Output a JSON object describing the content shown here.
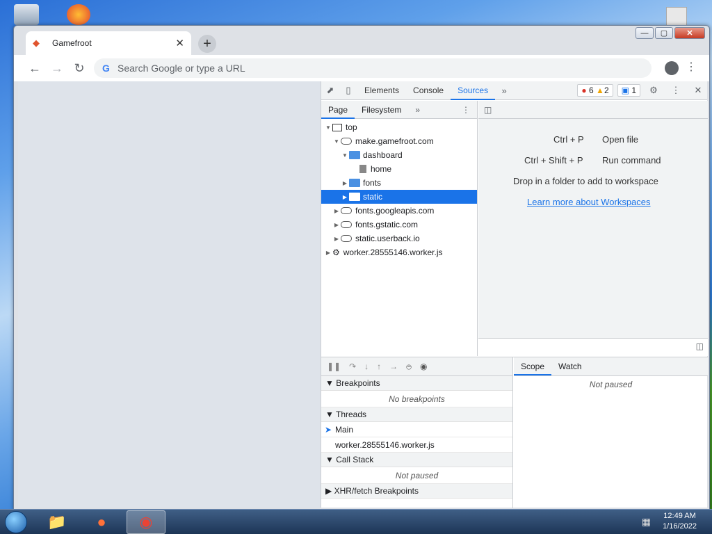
{
  "window": {
    "tab_title": "Gamefroot",
    "tab_close": "✕",
    "new_tab": "+",
    "controls": {
      "minimize": "—",
      "maximize": "▢",
      "close": "✕"
    }
  },
  "toolbar": {
    "back": "←",
    "forward": "→",
    "reload": "↻",
    "omnibox_placeholder": "Search Google or type a URL",
    "menu": "⋮"
  },
  "devtools": {
    "tabs": [
      "Elements",
      "Console",
      "Sources"
    ],
    "more_tabs": "»",
    "errors": "6",
    "warnings": "2",
    "messages": "1",
    "navigator": {
      "subtabs": [
        "Page",
        "Filesystem"
      ],
      "tree": [
        {
          "label": "top",
          "depth": 0,
          "arrow": "▼",
          "icon": "frame"
        },
        {
          "label": "make.gamefroot.com",
          "depth": 1,
          "arrow": "▼",
          "icon": "cloud"
        },
        {
          "label": "dashboard",
          "depth": 2,
          "arrow": "▼",
          "icon": "folder"
        },
        {
          "label": "home",
          "depth": 3,
          "arrow": "",
          "icon": "file"
        },
        {
          "label": "fonts",
          "depth": 2,
          "arrow": "▶",
          "icon": "folder"
        },
        {
          "label": "static",
          "depth": 2,
          "arrow": "▶",
          "icon": "folder",
          "selected": true
        },
        {
          "label": "fonts.googleapis.com",
          "depth": 1,
          "arrow": "▶",
          "icon": "cloud"
        },
        {
          "label": "fonts.gstatic.com",
          "depth": 1,
          "arrow": "▶",
          "icon": "cloud"
        },
        {
          "label": "static.userback.io",
          "depth": 1,
          "arrow": "▶",
          "icon": "cloud"
        },
        {
          "label": "worker.28555146.worker.js",
          "depth": 0,
          "arrow": "▶",
          "icon": "gear"
        }
      ]
    },
    "editor": {
      "shortcut1_keys": "Ctrl + P",
      "shortcut1_action": "Open file",
      "shortcut2_keys": "Ctrl + Shift + P",
      "shortcut2_action": "Run command",
      "drop_text": "Drop in a folder to add to workspace",
      "learn_link": "Learn more about Workspaces"
    },
    "debugger": {
      "breakpoints": "Breakpoints",
      "no_breakpoints": "No breakpoints",
      "threads": "Threads",
      "thread_main": "Main",
      "thread_worker": "worker.28555146.worker.js",
      "call_stack": "Call Stack",
      "not_paused": "Not paused",
      "xhr": "XHR/fetch Breakpoints",
      "scope_tab": "Scope",
      "watch_tab": "Watch",
      "scope_not_paused": "Not paused"
    }
  },
  "taskbar": {
    "time": "12:49 AM",
    "date": "1/16/2022"
  }
}
